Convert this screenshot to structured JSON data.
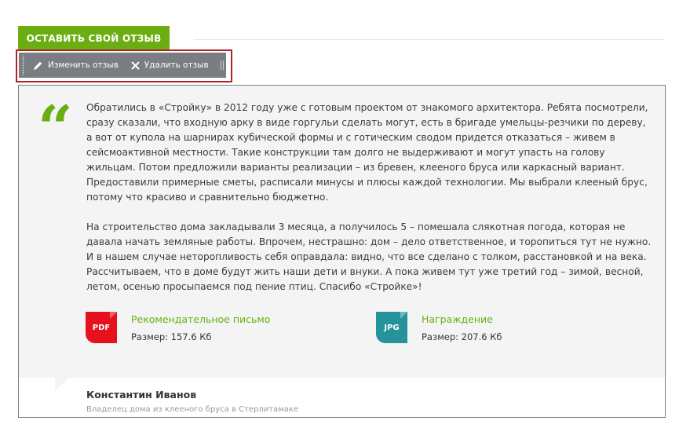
{
  "header": {
    "leave_review_label": "ОСТАВИТЬ СВОЙ ОТЗЫВ"
  },
  "toolbar": {
    "edit_label": "Изменить отзыв",
    "delete_label": "Удалить отзыв",
    "icons": [
      "pencil-icon",
      "close-icon"
    ]
  },
  "review": {
    "paragraphs": [
      "Обратились в «Стройку» в 2012 году уже с готовым проектом от знакомого архитектора. Ребята посмотрели, сразу сказали, что входную арку в виде горгульи сделать могут, есть в бригаде умельцы-резчики по дереву, а вот от купола на шарнирах кубической формы и с готическим сводом придется отказаться – живем в сейсмоактивной местности. Такие конструкции там долго не выдерживают и могут упасть на голову жильцам. Потом предложили варианты реализации – из бревен, клееного бруса или каркасный вариант. Предоставили примерные сметы, расписали минусы и плюсы каждой технологии. Мы выбрали клееный брус, потому что красиво и сравнительно бюджетно.",
      "На строительство дома закладывали 3 месяца, а получилось 5 – помешала слякотная погода, которая не давала начать земляные работы. Впрочем, нестрашно: дом – дело ответственное, и торопиться тут не нужно. И в нашем случае неторопливость себя оправдала: видно, что все сделано с толком, расстановкой и на века. Рассчитываем, что в доме будут жить наши дети и внуки. А пока живем тут уже третий год – зимой, весной, летом, осенью просыпаемся под пение птиц. Спасибо «Стройке»!"
    ],
    "attachments": [
      {
        "type": "PDF",
        "title": "Рекомендательное письмо",
        "size": "Размер: 157.6 Кб",
        "color": "#e5121e"
      },
      {
        "type": "JPG",
        "title": "Награждение",
        "size": "Размер: 207.6 Кб",
        "color": "#26939a"
      }
    ],
    "author_name": "Константин Иванов",
    "author_role": "Владелец дома из клееного бруса в Стерлитамаке"
  },
  "colors": {
    "accent": "#6aae12",
    "toolbar_bg": "#7a7d82",
    "highlight_border": "#b2202a"
  }
}
